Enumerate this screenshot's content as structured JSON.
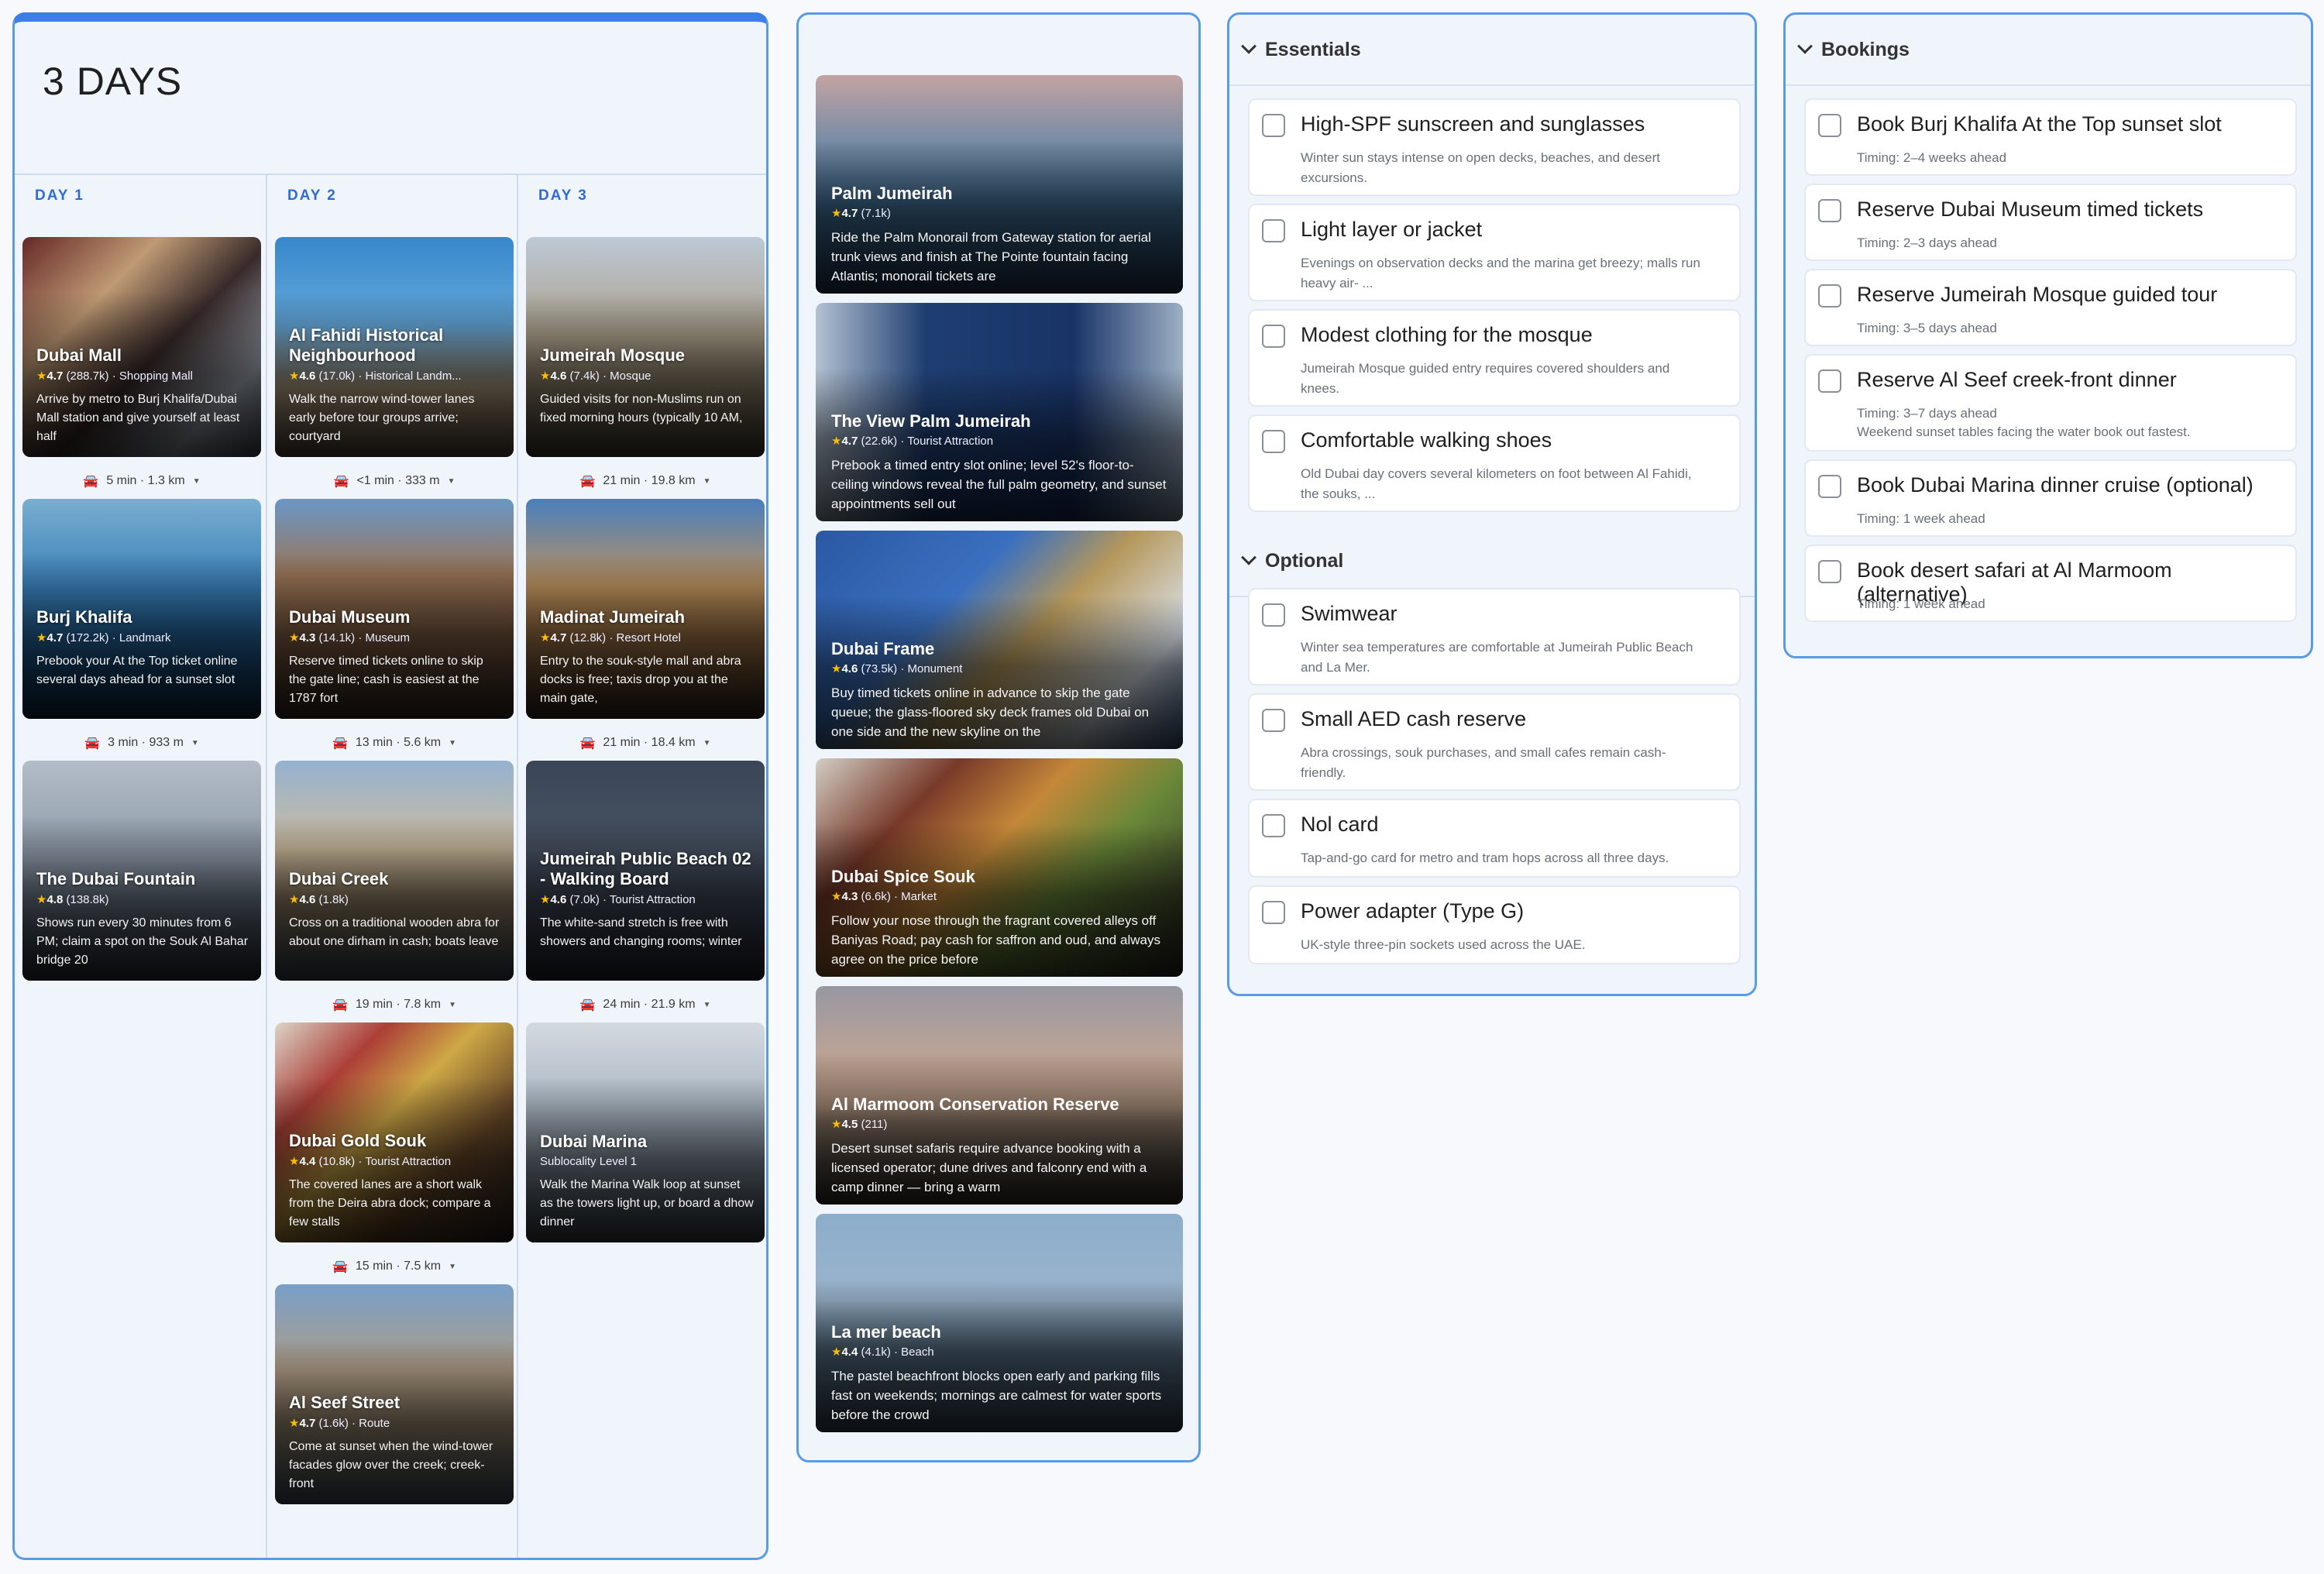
{
  "itinerary": {
    "title": "3 DAYS",
    "days": [
      {
        "label": "DAY 1",
        "cards": [
          {
            "name": "Dubai Mall",
            "rating": "4.7",
            "count": "(288.7k)",
            "category": "· Shopping Mall",
            "desc": "Arrive by metro to Burj Khalifa/Dubai Mall station and give yourself at least half"
          },
          {
            "name": "Burj Khalifa",
            "rating": "4.7",
            "count": "(172.2k)",
            "category": "· Landmark",
            "desc": "Prebook your At the Top ticket online several days ahead for a sunset slot"
          },
          {
            "name": "The Dubai Fountain",
            "rating": "4.8",
            "count": "(138.8k)",
            "category": "",
            "desc": "Shows run every 30 minutes from 6 PM; claim a spot on the Souk Al Bahar bridge 20"
          }
        ],
        "travel": [
          "5 min · 1.3 km",
          "3 min · 933 m"
        ]
      },
      {
        "label": "DAY 2",
        "cards": [
          {
            "name": "Al Fahidi Historical Neighbourhood",
            "rating": "4.6",
            "count": "(17.0k)",
            "category": "· Historical Landm...",
            "desc": "Walk the narrow wind-tower lanes early before tour groups arrive; courtyard"
          },
          {
            "name": "Dubai Museum",
            "rating": "4.3",
            "count": "(14.1k)",
            "category": "· Museum",
            "desc": "Reserve timed tickets online to skip the gate line; cash is easiest at the 1787 fort"
          },
          {
            "name": "Dubai Creek",
            "rating": "4.6",
            "count": "(1.8k)",
            "category": "",
            "desc": "Cross on a traditional wooden abra for about one dirham in cash; boats leave"
          },
          {
            "name": "Dubai Gold Souk",
            "rating": "4.4",
            "count": "(10.8k)",
            "category": "· Tourist Attraction",
            "desc": "The covered lanes are a short walk from the Deira abra dock; compare a few stalls"
          },
          {
            "name": "Al Seef Street",
            "rating": "4.7",
            "count": "(1.6k)",
            "category": "· Route",
            "desc": "Come at sunset when the wind-tower facades glow over the creek; creek-front"
          }
        ],
        "travel": [
          "<1 min · 333 m",
          "13 min · 5.6 km",
          "19 min · 7.8 km",
          "15 min · 7.5 km"
        ]
      },
      {
        "label": "DAY 3",
        "cards": [
          {
            "name": "Jumeirah Mosque",
            "rating": "4.6",
            "count": "(7.4k)",
            "category": "· Mosque",
            "desc": "Guided visits for non-Muslims run on fixed morning hours (typically 10 AM,"
          },
          {
            "name": "Madinat Jumeirah",
            "rating": "4.7",
            "count": "(12.8k)",
            "category": "· Resort Hotel",
            "desc": "Entry to the souk-style mall and abra docks is free; taxis drop you at the main gate,"
          },
          {
            "name": "Jumeirah Public Beach 02 - Walking Board",
            "rating": "4.6",
            "count": "(7.0k)",
            "category": "· Tourist Attraction",
            "desc": "The white-sand stretch is free with showers and changing rooms; winter"
          },
          {
            "name": "Dubai Marina",
            "rating": "",
            "count": "",
            "category": "Sublocality Level 1",
            "desc": "Walk the Marina Walk loop at sunset as the towers light up, or board a dhow dinner"
          }
        ],
        "travel": [
          "21 min · 19.8 km",
          "21 min · 18.4 km",
          "24 min · 21.9 km"
        ]
      }
    ]
  },
  "gallery": [
    {
      "name": "Palm Jumeirah",
      "rating": "4.7",
      "count": "(7.1k)",
      "category": "",
      "desc": "Ride the Palm Monorail from Gateway station for aerial trunk views and finish at The Pointe fountain facing Atlantis; monorail tickets are"
    },
    {
      "name": "The View Palm Jumeirah",
      "rating": "4.7",
      "count": "(22.6k)",
      "category": "· Tourist Attraction",
      "desc": "Prebook a timed entry slot online; level 52's floor-to-ceiling windows reveal the full palm geometry, and sunset appointments sell out"
    },
    {
      "name": "Dubai Frame",
      "rating": "4.6",
      "count": "(73.5k)",
      "category": "· Monument",
      "desc": "Buy timed tickets online in advance to skip the gate queue; the glass-floored sky deck frames old Dubai on one side and the new skyline on the"
    },
    {
      "name": "Dubai Spice Souk",
      "rating": "4.3",
      "count": "(6.6k)",
      "category": "· Market",
      "desc": "Follow your nose through the fragrant covered alleys off Baniyas Road; pay cash for saffron and oud, and always agree on the price before"
    },
    {
      "name": "Al Marmoom Conservation Reserve",
      "rating": "4.5",
      "count": "(211)",
      "category": "",
      "desc": "Desert sunset safaris require advance booking with a licensed operator; dune drives and falconry end with a camp dinner — bring a warm"
    },
    {
      "name": "La mer beach",
      "rating": "4.4",
      "count": "(4.1k)",
      "category": "· Beach",
      "desc": "The pastel beachfront blocks open early and parking fills fast on weekends; mornings are calmest for water sports before the crowd"
    }
  ],
  "essentials": {
    "header": "Essentials",
    "items": [
      {
        "title": "High-SPF sunscreen and sunglasses",
        "sub": "Winter sun stays intense on open decks, beaches, and desert excursions."
      },
      {
        "title": "Light layer or jacket",
        "sub": "Evenings on observation decks and the marina get breezy; malls run heavy air- ..."
      },
      {
        "title": "Modest clothing for the mosque",
        "sub": "Jumeirah Mosque guided entry requires covered shoulders and knees."
      },
      {
        "title": "Comfortable walking shoes",
        "sub": "Old Dubai day covers several kilometers on foot between Al Fahidi, the souks, ..."
      }
    ]
  },
  "optional": {
    "header": "Optional",
    "items": [
      {
        "title": "Swimwear",
        "sub": "Winter sea temperatures are comfortable at Jumeirah Public Beach and La Mer."
      },
      {
        "title": "Small AED cash reserve",
        "sub": "Abra crossings, souk purchases, and small cafes remain cash-friendly."
      },
      {
        "title": "Nol card",
        "sub": "Tap-and-go card for metro and tram hops across all three days."
      },
      {
        "title": "Power adapter (Type G)",
        "sub": "UK-style three-pin sockets used across the UAE."
      }
    ]
  },
  "bookings": {
    "header": "Bookings",
    "items": [
      {
        "title": "Book Burj Khalifa At the Top sunset slot",
        "sub": "Timing: 2–4 weeks ahead",
        "sub2": ""
      },
      {
        "title": "Reserve Dubai Museum timed tickets",
        "sub": "Timing: 2–3 days ahead",
        "sub2": ""
      },
      {
        "title": "Reserve Jumeirah Mosque guided tour",
        "sub": "Timing: 3–5 days ahead",
        "sub2": ""
      },
      {
        "title": "Reserve Al Seef creek-front dinner",
        "sub": "Timing: 3–7 days ahead",
        "sub2": "Weekend sunset tables facing the water book out fastest."
      },
      {
        "title": "Book Dubai Marina dinner cruise (optional)",
        "sub": "Timing: 1 week ahead",
        "sub2": ""
      },
      {
        "title": "Book desert safari at Al Marmoom (alternative)",
        "sub": "Timing: 1 week ahead",
        "sub2": ""
      }
    ]
  },
  "icons": {
    "star": "star-icon",
    "car": "car-icon",
    "caret": "caret-down-icon",
    "chevron": "chevron-down-icon",
    "checkbox": "checkbox-icon"
  },
  "colors": {
    "accent": "#2f6bd6",
    "panel_border": "#5a9be6",
    "star": "#fbbc04"
  }
}
